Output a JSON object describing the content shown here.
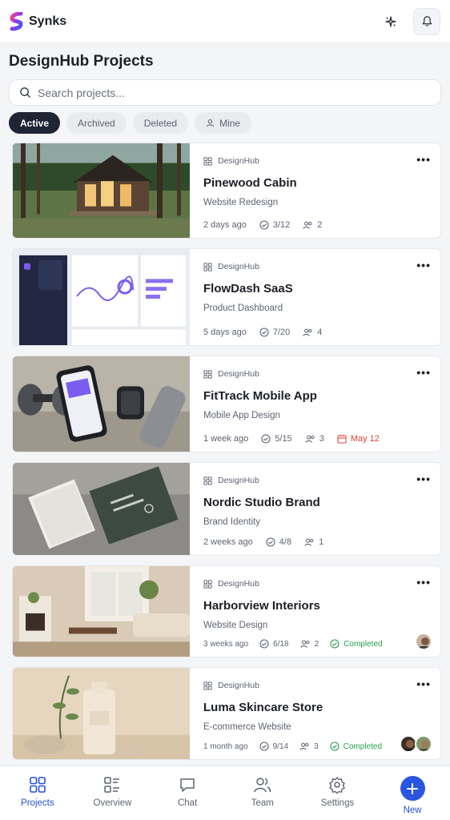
{
  "app": {
    "name": "Synks"
  },
  "page": {
    "title": "DesignHub Projects"
  },
  "search": {
    "placeholder": "Search projects..."
  },
  "filters": [
    {
      "label": "Active",
      "active": true
    },
    {
      "label": "Archived"
    },
    {
      "label": "Deleted"
    },
    {
      "label": "Mine",
      "icon": "user-icon"
    }
  ],
  "projects": [
    {
      "org": "DesignHub",
      "title": "Pinewood Cabin",
      "subtitle": "Website Redesign",
      "updated": "2 days ago",
      "tasks": "3/12",
      "members": "2"
    },
    {
      "org": "DesignHub",
      "title": "FlowDash SaaS",
      "subtitle": "Product Dashboard",
      "updated": "5 days ago",
      "tasks": "7/20",
      "members": "4"
    },
    {
      "org": "DesignHub",
      "title": "FitTrack Mobile App",
      "subtitle": "Mobile App Design",
      "updated": "1 week ago",
      "tasks": "5/15",
      "members": "3",
      "due": "May 12"
    },
    {
      "org": "DesignHub",
      "title": "Nordic Studio Brand",
      "subtitle": "Brand Identity",
      "updated": "2 weeks ago",
      "tasks": "4/8",
      "members": "1"
    },
    {
      "org": "DesignHub",
      "title": "Harborview Interiors",
      "subtitle": "Website Design",
      "updated": "3 weeks ago",
      "tasks": "6/18",
      "members": "2",
      "status": "Completed"
    },
    {
      "org": "DesignHub",
      "title": "Luma Skincare Store",
      "subtitle": "E-commerce Website",
      "updated": "1 month ago",
      "tasks": "9/14",
      "members": "3",
      "status": "Completed"
    }
  ],
  "nav": [
    {
      "label": "Projects",
      "icon": "grid-icon",
      "active": true
    },
    {
      "label": "Overview",
      "icon": "list-icon"
    },
    {
      "label": "Chat",
      "icon": "chat-icon"
    },
    {
      "label": "Team",
      "icon": "team-icon"
    },
    {
      "label": "Settings",
      "icon": "gear-icon"
    },
    {
      "label": "New",
      "icon": "plus-icon"
    }
  ],
  "colors": {
    "accent": "#2a55e0",
    "due": "#e0413a",
    "completed": "#22a04b",
    "chip_active": "#1f2535"
  }
}
